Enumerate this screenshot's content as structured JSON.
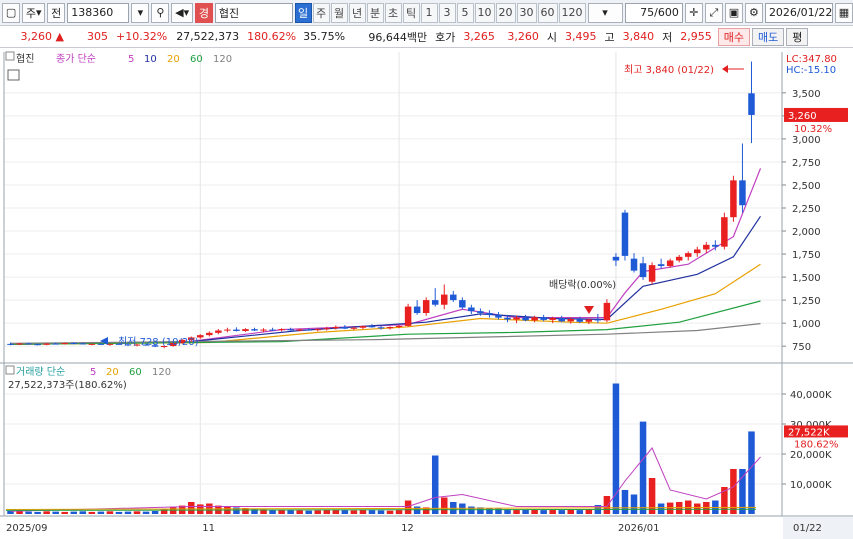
{
  "toolbar": {
    "market_label": "주",
    "board_label": "전",
    "stock_code": "138360",
    "stock_name": "협진",
    "stock_badge": "경",
    "periods": [
      "일",
      "주",
      "월",
      "년",
      "분",
      "초",
      "틱",
      "1",
      "3",
      "5",
      "10",
      "20",
      "30",
      "60",
      "120"
    ],
    "active_period": "일",
    "count_value": "75",
    "count_total": "/600",
    "date_value": "2026/01/22"
  },
  "quote": {
    "price": "3,260",
    "change_arrow": "▲",
    "change": "305",
    "change_pct": "+10.32%",
    "volume": "27,522,373",
    "volume_ratio": "180.62%",
    "turnover": "35.75%",
    "amount": "96,644백만",
    "ask_label": "호가",
    "ask": "3,265",
    "bid": "3,260",
    "open_label": "시",
    "open": "3,495",
    "high_label": "고",
    "high": "3,840",
    "low_label": "저",
    "low": "2,955",
    "buy_label": "매수",
    "sell_label": "매도",
    "eval_label": "평"
  },
  "price_panel": {
    "stock_tag": "협진",
    "legend_prefix": "종가 단순",
    "ma_labels": [
      "5",
      "10",
      "20",
      "60",
      "120"
    ],
    "ma_colors": [
      "#c040c0",
      "#2030a0",
      "#e8a000",
      "#20a040",
      "#808080"
    ],
    "lc_label": "LC:347.80",
    "hc_label": "HC:-15.10",
    "current_price_label": "3,260",
    "current_pct_label": "10.32%",
    "high_annotation": "최고 3,840 (01/22)",
    "low_annotation": "최저 728 (10/20)",
    "dividend_annotation": "배당락(0.00%)"
  },
  "volume_panel": {
    "legend_prefix": "거래량 단순",
    "ma_labels": [
      "5",
      "20",
      "60",
      "120"
    ],
    "ma_colors": [
      "#c040c0",
      "#e8a000",
      "#20a040",
      "#808080"
    ],
    "volume_text": "27,522,373주(180.62%)",
    "current_volume_label": "27,522K",
    "current_volume_pct": "180.62%"
  },
  "date_axis": {
    "labels": [
      "2025/09",
      "11",
      "12",
      "2026/01"
    ],
    "right_label": "01/22"
  },
  "colors": {
    "up": "#e82020",
    "down": "#1f5ad6",
    "bg": "#ffffff"
  },
  "chart_data": {
    "type": "candlestick",
    "price_axis": {
      "ticks": [
        750,
        1000,
        1250,
        1500,
        1750,
        2000,
        2250,
        2500,
        2750,
        3000,
        3250,
        3500
      ],
      "tick_labels": [
        "750",
        "1,000",
        "1,250",
        "1,500",
        "1,750",
        "2,000",
        "2,250",
        "2,500",
        "2,750",
        "3,000",
        "3,250",
        "3,500"
      ],
      "range": [
        600,
        3900
      ]
    },
    "volume_axis": {
      "ticks": [
        10000,
        20000,
        30000,
        40000
      ],
      "tick_labels": [
        "10,000K",
        "20,000K",
        "30,000K",
        "40,000K"
      ],
      "range": [
        0,
        48000
      ]
    },
    "candles": [
      [
        775,
        790,
        760,
        770,
        1000
      ],
      [
        770,
        785,
        762,
        780,
        900
      ],
      [
        780,
        790,
        768,
        772,
        800
      ],
      [
        772,
        778,
        758,
        765,
        700
      ],
      [
        765,
        785,
        760,
        778,
        900
      ],
      [
        778,
        790,
        770,
        775,
        800
      ],
      [
        775,
        790,
        768,
        785,
        700
      ],
      [
        785,
        795,
        772,
        780,
        800
      ],
      [
        780,
        790,
        770,
        770,
        900
      ],
      [
        770,
        780,
        760,
        775,
        700
      ],
      [
        775,
        785,
        762,
        768,
        800
      ],
      [
        768,
        780,
        755,
        775,
        900
      ],
      [
        775,
        785,
        768,
        770,
        700
      ],
      [
        770,
        780,
        750,
        765,
        800
      ],
      [
        765,
        775,
        748,
        768,
        900
      ],
      [
        768,
        780,
        755,
        760,
        800
      ],
      [
        760,
        770,
        740,
        745,
        1000
      ],
      [
        745,
        760,
        728,
        752,
        1500
      ],
      [
        752,
        790,
        745,
        785,
        2200
      ],
      [
        785,
        825,
        775,
        818,
        2800
      ],
      [
        818,
        855,
        800,
        845,
        4000
      ],
      [
        845,
        880,
        830,
        870,
        3200
      ],
      [
        870,
        910,
        855,
        895,
        3500
      ],
      [
        895,
        935,
        880,
        920,
        2800
      ],
      [
        920,
        950,
        900,
        930,
        2400
      ],
      [
        930,
        955,
        910,
        915,
        2200
      ],
      [
        915,
        945,
        905,
        935,
        2000
      ],
      [
        935,
        950,
        915,
        920,
        1800
      ],
      [
        920,
        945,
        900,
        930,
        1600
      ],
      [
        930,
        950,
        915,
        925,
        1500
      ],
      [
        925,
        945,
        910,
        935,
        1400
      ],
      [
        935,
        950,
        918,
        922,
        1300
      ],
      [
        922,
        940,
        910,
        930,
        1200
      ],
      [
        930,
        945,
        918,
        925,
        1100
      ],
      [
        925,
        942,
        912,
        935,
        1200
      ],
      [
        935,
        960,
        920,
        945,
        1400
      ],
      [
        945,
        975,
        930,
        958,
        1500
      ],
      [
        958,
        980,
        935,
        940,
        1300
      ],
      [
        940,
        960,
        925,
        950,
        1200
      ],
      [
        950,
        975,
        935,
        968,
        1400
      ],
      [
        968,
        990,
        950,
        955,
        1300
      ],
      [
        955,
        970,
        930,
        945,
        1200
      ],
      [
        945,
        965,
        930,
        958,
        1100
      ],
      [
        958,
        980,
        945,
        970,
        1300
      ],
      [
        970,
        1210,
        960,
        1180,
        4500
      ],
      [
        1180,
        1250,
        1090,
        1110,
        2500
      ],
      [
        1110,
        1280,
        1080,
        1250,
        2200
      ],
      [
        1250,
        1380,
        1180,
        1200,
        19500
      ],
      [
        1200,
        1420,
        1150,
        1310,
        5500
      ],
      [
        1310,
        1350,
        1230,
        1250,
        4000
      ],
      [
        1250,
        1280,
        1150,
        1170,
        3500
      ],
      [
        1170,
        1200,
        1100,
        1130,
        2500
      ],
      [
        1130,
        1160,
        1080,
        1110,
        2200
      ],
      [
        1110,
        1140,
        1060,
        1090,
        2000
      ],
      [
        1090,
        1120,
        1040,
        1060,
        1800
      ],
      [
        1060,
        1090,
        1010,
        1040,
        1600
      ],
      [
        1040,
        1080,
        1000,
        1060,
        1500
      ],
      [
        1060,
        1090,
        1020,
        1030,
        1400
      ],
      [
        1030,
        1080,
        1010,
        1065,
        1500
      ],
      [
        1065,
        1090,
        1020,
        1035,
        1300
      ],
      [
        1035,
        1070,
        1000,
        1055,
        1400
      ],
      [
        1055,
        1080,
        1010,
        1020,
        1300
      ],
      [
        1020,
        1060,
        995,
        1045,
        1400
      ],
      [
        1045,
        1070,
        1000,
        1015,
        1300
      ],
      [
        1015,
        1050,
        990,
        1040,
        1500
      ],
      [
        1040,
        1100,
        1000,
        1030,
        3000
      ],
      [
        1030,
        1260,
        1010,
        1220,
        6000
      ],
      [
        1720,
        1760,
        1620,
        1680,
        43500
      ],
      [
        2200,
        2230,
        1680,
        1730,
        8000
      ],
      [
        1700,
        1760,
        1550,
        1570,
        6500
      ],
      [
        1650,
        1720,
        1470,
        1500,
        30800
      ],
      [
        1450,
        1660,
        1420,
        1630,
        12000
      ],
      [
        1640,
        1700,
        1590,
        1620,
        3500
      ],
      [
        1620,
        1700,
        1600,
        1680,
        3800
      ],
      [
        1680,
        1740,
        1660,
        1720,
        4000
      ],
      [
        1720,
        1780,
        1680,
        1760,
        4500
      ],
      [
        1760,
        1830,
        1720,
        1800,
        3500
      ],
      [
        1800,
        1880,
        1760,
        1850,
        4000
      ],
      [
        1850,
        1900,
        1790,
        1830,
        4500
      ],
      [
        1830,
        2200,
        1800,
        2150,
        9000
      ],
      [
        2150,
        2600,
        2100,
        2550,
        15000
      ],
      [
        2550,
        2950,
        2200,
        2280,
        15000
      ],
      [
        3495,
        3840,
        2955,
        3260,
        27522
      ]
    ],
    "ma": {
      "5": [
        [
          0,
          770
        ],
        [
          19,
          790
        ],
        [
          30,
          930
        ],
        [
          44,
          985
        ],
        [
          50,
          1150
        ],
        [
          56,
          1060
        ],
        [
          66,
          1060
        ],
        [
          68,
          1330
        ],
        [
          70,
          1560
        ],
        [
          75,
          1640
        ],
        [
          80,
          1940
        ],
        [
          83,
          2680
        ]
      ],
      "10": [
        [
          0,
          770
        ],
        [
          20,
          800
        ],
        [
          32,
          920
        ],
        [
          46,
          1010
        ],
        [
          52,
          1100
        ],
        [
          60,
          1050
        ],
        [
          66,
          1040
        ],
        [
          70,
          1400
        ],
        [
          76,
          1530
        ],
        [
          80,
          1720
        ],
        [
          83,
          2160
        ]
      ],
      "20": [
        [
          0,
          770
        ],
        [
          22,
          790
        ],
        [
          34,
          900
        ],
        [
          44,
          960
        ],
        [
          52,
          1050
        ],
        [
          62,
          1010
        ],
        [
          66,
          1000
        ],
        [
          72,
          1150
        ],
        [
          78,
          1320
        ],
        [
          83,
          1640
        ]
      ],
      "60": [
        [
          0,
          770
        ],
        [
          30,
          800
        ],
        [
          44,
          880
        ],
        [
          56,
          900
        ],
        [
          66,
          930
        ],
        [
          74,
          1010
        ],
        [
          83,
          1240
        ]
      ],
      "120": [
        [
          0,
          780
        ],
        [
          40,
          820
        ],
        [
          66,
          880
        ],
        [
          76,
          920
        ],
        [
          83,
          995
        ]
      ]
    },
    "vol_ma5": [
      [
        0,
        900
      ],
      [
        20,
        2500
      ],
      [
        44,
        2500
      ],
      [
        47,
        5500
      ],
      [
        50,
        6500
      ],
      [
        56,
        2500
      ],
      [
        66,
        2500
      ],
      [
        68,
        11000
      ],
      [
        71,
        22000
      ],
      [
        73,
        8000
      ],
      [
        77,
        5000
      ],
      [
        80,
        9000
      ],
      [
        83,
        19000
      ]
    ]
  }
}
